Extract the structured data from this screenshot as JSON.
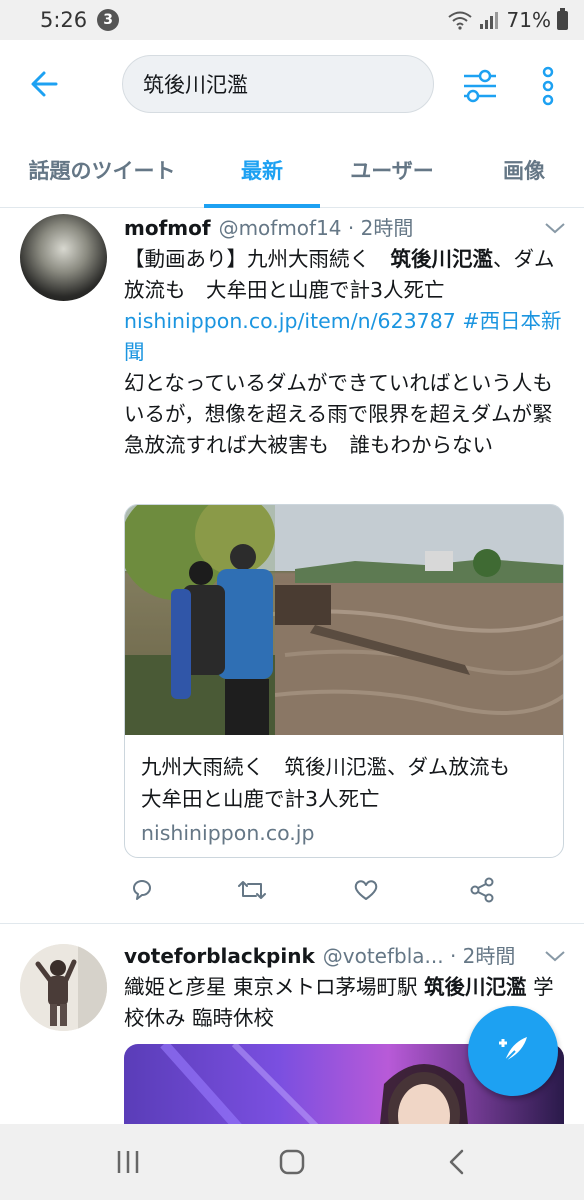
{
  "status_bar": {
    "time": "5:26",
    "notification_count": "3",
    "battery": "71%"
  },
  "search": {
    "query": "筑後川氾濫"
  },
  "tabs": [
    {
      "label": "話題のツイート",
      "active": false
    },
    {
      "label": "最新",
      "active": true
    },
    {
      "label": "ユーザー",
      "active": false
    },
    {
      "label": "画像",
      "active": false
    }
  ],
  "tweets": [
    {
      "author": "mofmof",
      "handle": "@mofmof14 · 2時間",
      "text_parts": [
        "【動画あり】九州大雨続く　",
        "筑後川氾濫",
        "、ダム放流も　大牟田と山鹿で計3人死亡 "
      ],
      "link_text": "nishinippon.co.jp/item/n/623787",
      "hashtag": "#西日本新聞",
      "text2": "幻となっているダムができていればという人もいるが，想像を超える雨で限界を超えダムが緊急放流すれば大被害も　誰もわからない",
      "card": {
        "title": "九州大雨続く　筑後川氾濫、ダム放流も　大牟田と山鹿で計3人死亡",
        "domain": "nishinippon.co.jp"
      }
    },
    {
      "author": "voteforblackpink",
      "handle": "@votefbla... · 2時間",
      "text_parts": [
        "織姫と彦星 東京メトロ茅場町駅 ",
        "筑後川氾濫",
        " 学校休み 臨時休校"
      ]
    }
  ],
  "colors": {
    "accent": "#1da1f2",
    "link": "#1b95e0",
    "muted": "#657786"
  },
  "icons": {
    "back": "arrow-left-icon",
    "filter": "sliders-icon",
    "more": "vertical-dots-icon",
    "reply": "reply-icon",
    "retweet": "retweet-icon",
    "like": "heart-icon",
    "share": "share-icon",
    "compose": "compose-icon"
  }
}
